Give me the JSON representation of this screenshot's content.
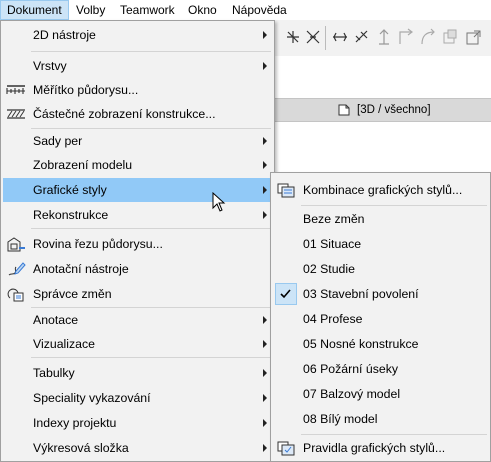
{
  "menubar": {
    "items": [
      "Dokument",
      "Volby",
      "Teamwork",
      "Okno",
      "Nápověda"
    ]
  },
  "tabbar": {
    "view_label": "[3D / všechno]"
  },
  "menu": {
    "items": [
      {
        "label": "2D nástroje",
        "submenu": true
      },
      {
        "label": "Vrstvy",
        "submenu": true
      },
      {
        "label": "Měřítko půdorysu...",
        "icon": "scale-icon"
      },
      {
        "label": "Částečné zobrazení konstrukce...",
        "icon": "partial-structure-icon"
      },
      {
        "label": "Sady per",
        "submenu": true
      },
      {
        "label": "Zobrazení modelu",
        "submenu": true
      },
      {
        "label": "Grafické styly",
        "submenu": true,
        "highlighted": true
      },
      {
        "label": "Rekonstrukce",
        "submenu": true
      },
      {
        "label": "Rovina řezu půdorysu...",
        "icon": "floor-plan-cut-plane-icon"
      },
      {
        "label": "Anotační nástroje",
        "icon": "annotation-tools-icon"
      },
      {
        "label": "Správce změn",
        "icon": "change-manager-icon"
      },
      {
        "label": "Anotace",
        "submenu": true
      },
      {
        "label": "Vizualizace",
        "submenu": true
      },
      {
        "label": "Tabulky",
        "submenu": true
      },
      {
        "label": "Speciality vykazování",
        "submenu": true
      },
      {
        "label": "Indexy projektu",
        "submenu": true
      },
      {
        "label": "Výkresová složka",
        "submenu": true
      }
    ]
  },
  "submenu": {
    "combo_label": "Kombinace grafických stylů...",
    "options": [
      "Beze změn",
      "01 Situace",
      "02 Studie",
      "03 Stavební povolení",
      "04 Profese",
      "05 Nosné konstrukce",
      "06 Požární úseky",
      "07 Balzový model",
      "08 Bílý model"
    ],
    "checked_option": "03 Stavební povolení",
    "rules_label": "Pravidla grafických stylů..."
  },
  "colors": {
    "highlight": "#91c9f7",
    "menubar_active": "#cce4f7",
    "menu_bg": "#f2f2f2"
  }
}
